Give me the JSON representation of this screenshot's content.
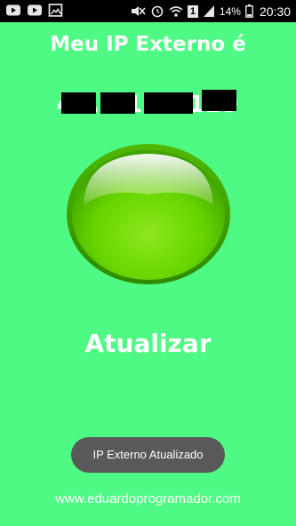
{
  "status_bar": {
    "battery_percent": "14%",
    "time": "20:30",
    "sim_label": "1",
    "icons": [
      "youtube-icon",
      "youtube-icon",
      "gallery-icon",
      "mute-icon",
      "alarm-icon",
      "wifi-icon",
      "sim-icon",
      "signal-icon",
      "battery-icon"
    ]
  },
  "app": {
    "title": "Meu IP Externo é",
    "ip_value": "45.7 1.1 .129",
    "refresh_label": "Atualizar",
    "toast": "IP Externo Atualizado",
    "website": "www.eduardoprogramador.com"
  },
  "colors": {
    "background": "#4efa83",
    "button_green": "#66d400",
    "toast_bg": "#595959"
  }
}
